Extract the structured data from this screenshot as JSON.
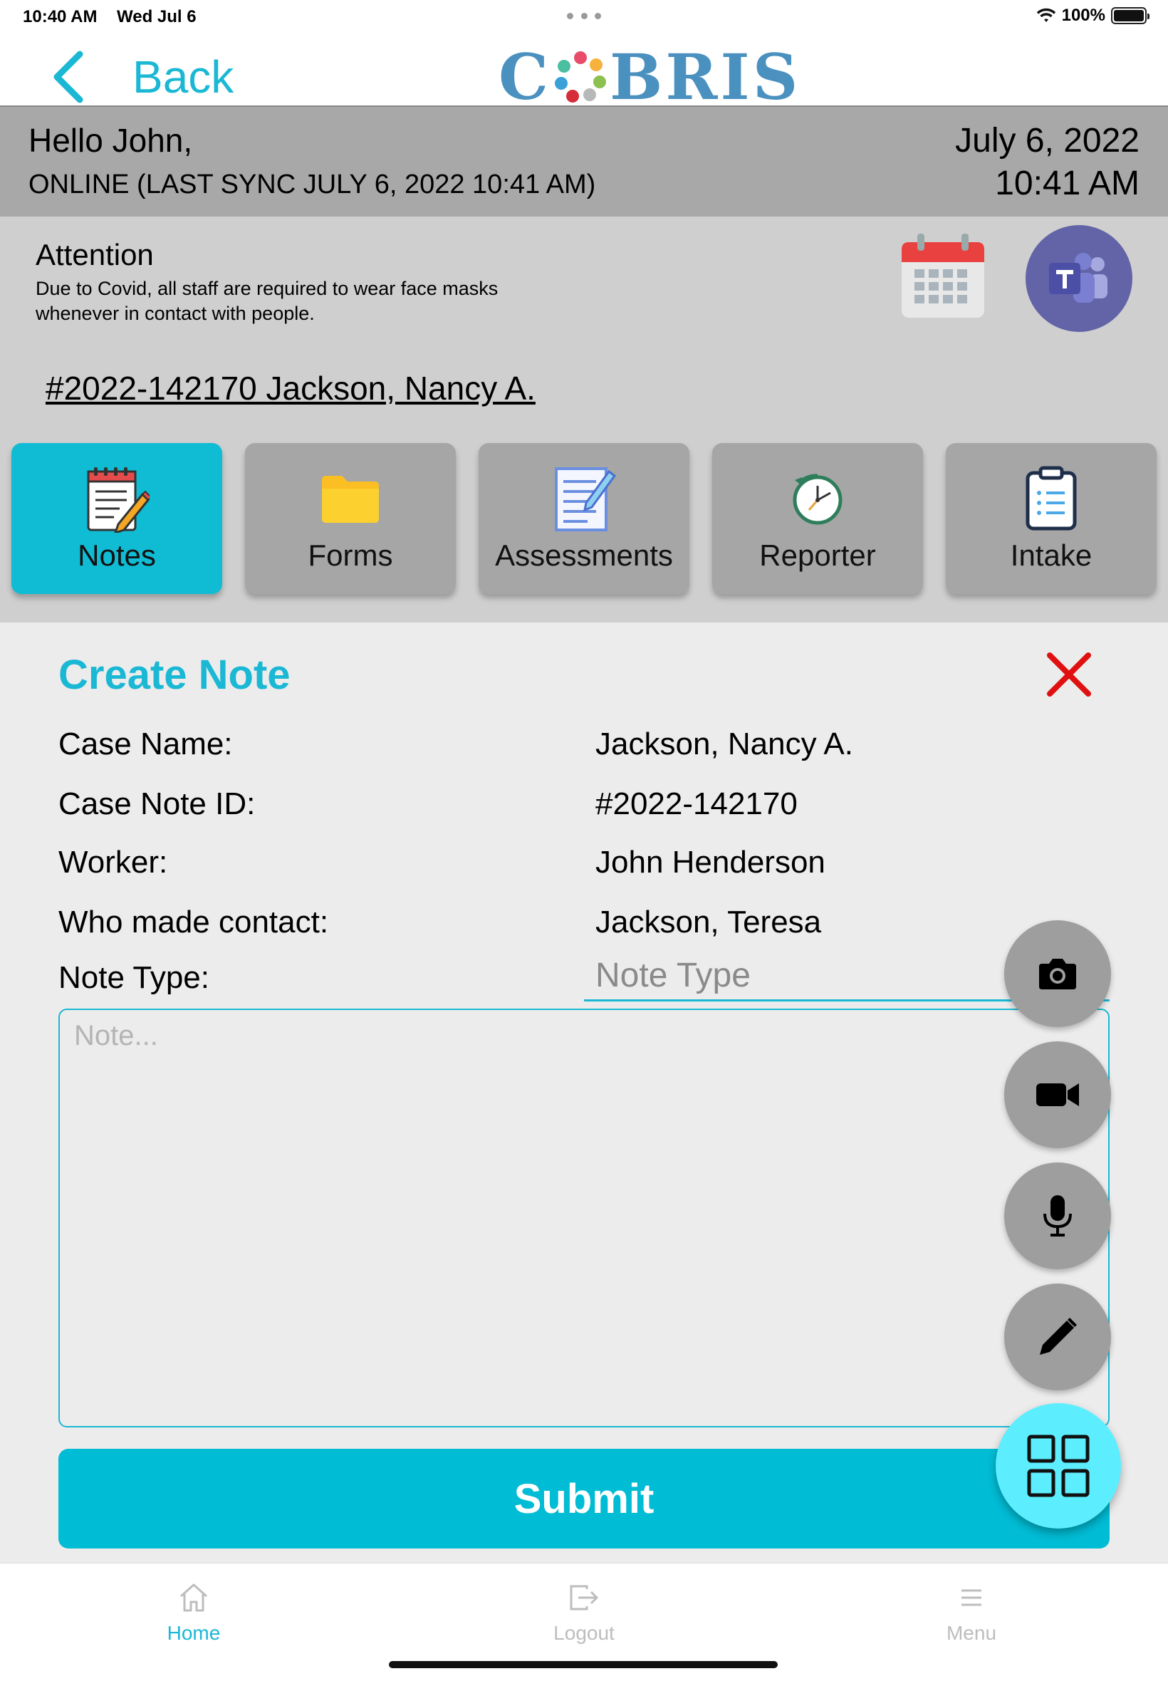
{
  "status_bar": {
    "time": "10:40 AM",
    "date": "Wed Jul 6",
    "battery": "100%",
    "battery_level": 1.0
  },
  "nav": {
    "back_label": "Back",
    "logo_text_left": "C",
    "logo_text_right": "BRIS"
  },
  "header": {
    "greeting": "Hello John,",
    "sync_status": "ONLINE (LAST SYNC JULY 6, 2022 10:41 AM)",
    "date": "July 6, 2022",
    "time": "10:41 AM"
  },
  "attention": {
    "title": "Attention",
    "message": "Due to Covid, all staff are required to wear face masks whenever in contact with people."
  },
  "case": {
    "link_text": "#2022-142170 Jackson, Nancy A."
  },
  "tiles": [
    {
      "label": "Notes",
      "icon": "notes-icon",
      "active": true
    },
    {
      "label": "Forms",
      "icon": "folder-icon",
      "active": false
    },
    {
      "label": "Assessments",
      "icon": "assessment-icon",
      "active": false
    },
    {
      "label": "Reporter",
      "icon": "clock-icon",
      "active": false
    },
    {
      "label": "Intake",
      "icon": "clipboard-icon",
      "active": false
    }
  ],
  "create_note": {
    "title": "Create Note",
    "fields": [
      {
        "label": "Case Name:",
        "value": "Jackson, Nancy A."
      },
      {
        "label": "Case Note ID:",
        "value": "#2022-142170"
      },
      {
        "label": "Worker:",
        "value": "John Henderson"
      },
      {
        "label": "Who made contact:",
        "value": "Jackson, Teresa"
      }
    ],
    "note_type_label": "Note Type:",
    "note_type_placeholder": "Note Type",
    "note_placeholder": "Note...",
    "submit_label": "Submit"
  },
  "fab_actions": [
    "camera-icon",
    "video-icon",
    "microphone-icon",
    "pencil-icon",
    "grid-icon"
  ],
  "tab_bar": [
    {
      "label": "Home",
      "icon": "home-icon",
      "active": true
    },
    {
      "label": "Logout",
      "icon": "logout-icon",
      "active": false
    },
    {
      "label": "Menu",
      "icon": "menu-icon",
      "active": false
    }
  ],
  "colors": {
    "accent": "#1ab8d4",
    "submit": "#00bcd4",
    "header_band": "#a8a8a8",
    "info_area": "#cfcfcf",
    "close": "#e01010",
    "fab": "#9e9e9e",
    "fab_main": "#5ceeff",
    "teams": "#6264a7"
  }
}
